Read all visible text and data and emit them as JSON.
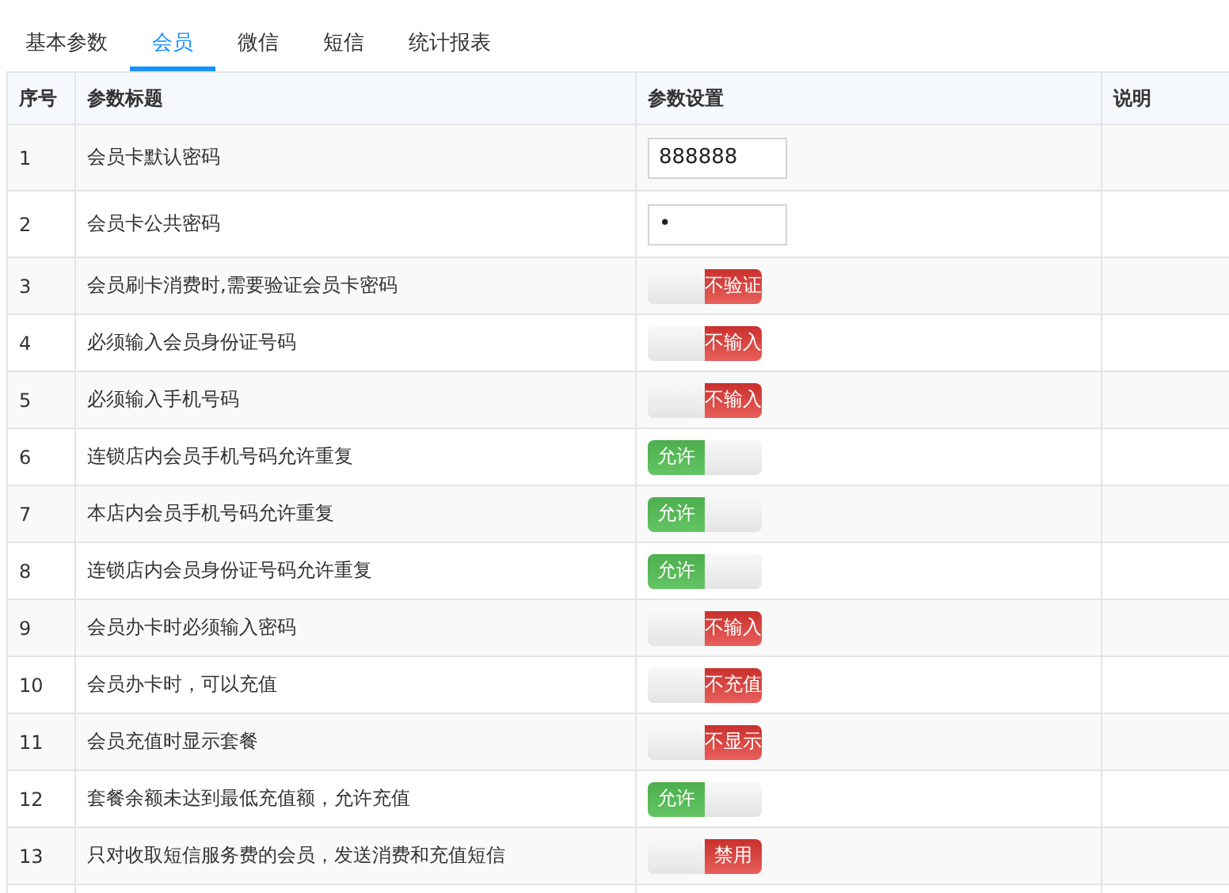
{
  "tabs": [
    {
      "label": "基本参数",
      "selected": false
    },
    {
      "label": "会员",
      "selected": true
    },
    {
      "label": "微信",
      "selected": false
    },
    {
      "label": "短信",
      "selected": false
    },
    {
      "label": "统计报表",
      "selected": false
    }
  ],
  "table": {
    "columns": [
      "序号",
      "参数标题",
      "参数设置",
      "说明"
    ],
    "rows": [
      {
        "index": "1",
        "title": "会员卡默认密码",
        "setting": {
          "kind": "input",
          "value": "888888"
        }
      },
      {
        "index": "2",
        "title": "会员卡公共密码",
        "setting": {
          "kind": "input",
          "value": "•"
        }
      },
      {
        "index": "3",
        "title": "会员刷卡消费时,需要验证会员卡密码",
        "setting": {
          "kind": "toggle",
          "on": false,
          "label": "不验证"
        }
      },
      {
        "index": "4",
        "title": "必须输入会员身份证号码",
        "setting": {
          "kind": "toggle",
          "on": false,
          "label": "不输入"
        }
      },
      {
        "index": "5",
        "title": "必须输入手机号码",
        "setting": {
          "kind": "toggle",
          "on": false,
          "label": "不输入"
        }
      },
      {
        "index": "6",
        "title": "连锁店内会员手机号码允许重复",
        "setting": {
          "kind": "toggle",
          "on": true,
          "label": "允许"
        }
      },
      {
        "index": "7",
        "title": "本店内会员手机号码允许重复",
        "setting": {
          "kind": "toggle",
          "on": true,
          "label": "允许"
        }
      },
      {
        "index": "8",
        "title": "连锁店内会员身份证号码允许重复",
        "setting": {
          "kind": "toggle",
          "on": true,
          "label": "允许"
        }
      },
      {
        "index": "9",
        "title": "会员办卡时必须输入密码",
        "setting": {
          "kind": "toggle",
          "on": false,
          "label": "不输入"
        }
      },
      {
        "index": "10",
        "title": "会员办卡时，可以充值",
        "setting": {
          "kind": "toggle",
          "on": false,
          "label": "不充值"
        }
      },
      {
        "index": "11",
        "title": "会员充值时显示套餐",
        "setting": {
          "kind": "toggle",
          "on": false,
          "label": "不显示"
        }
      },
      {
        "index": "12",
        "title": "套餐余额未达到最低充值额，允许充值",
        "setting": {
          "kind": "toggle",
          "on": true,
          "label": "允许"
        }
      },
      {
        "index": "13",
        "title": "只对收取短信服务费的会员，发送消费和充值短信",
        "setting": {
          "kind": "toggle",
          "on": false,
          "label": "禁用"
        }
      }
    ]
  }
}
